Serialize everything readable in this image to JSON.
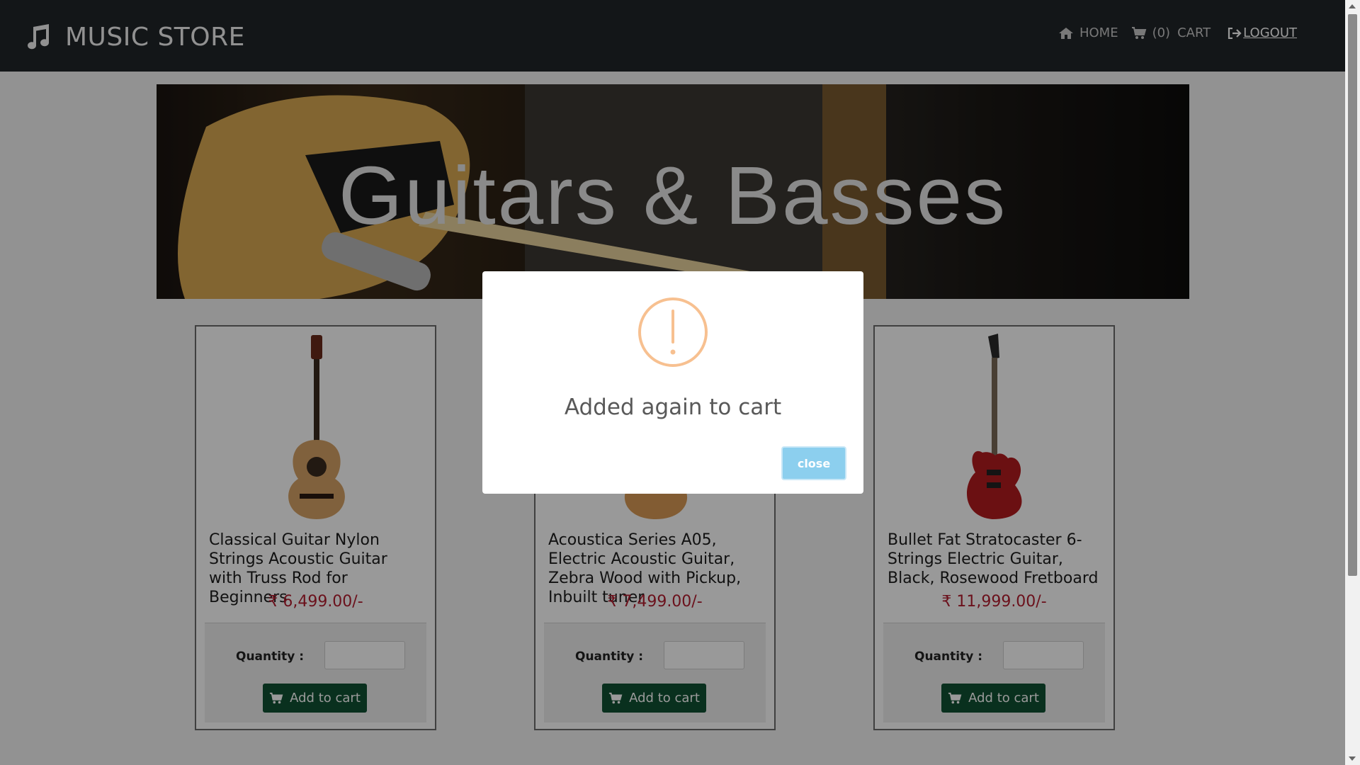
{
  "header": {
    "brand_icon": "music-note-icon",
    "brand": "MUSIC STORE",
    "nav": {
      "home_icon": "home-icon",
      "home": "HOME",
      "cart_icon": "cart-icon",
      "cart_count": "(0)",
      "cart": "CART",
      "logout_icon": "logout-icon",
      "logout": "LOGOUT"
    }
  },
  "banner": {
    "title": "Guitars & Basses"
  },
  "products": [
    {
      "name": "Classical Guitar Nylon Strings Acoustic Guitar with Truss Rod for Beginners",
      "price": "₹ 6,499.00/-",
      "quantity_label": "Quantity :",
      "add_label": "Add to cart"
    },
    {
      "name": "Acoustica Series A05, Electric Acoustic Guitar, Zebra Wood with Pickup, Inbuilt tuner",
      "price": "₹ 7,499.00/-",
      "quantity_label": "Quantity :",
      "add_label": "Add to cart"
    },
    {
      "name": "Bullet Fat Stratocaster 6-Strings Electric Guitar, Black, Rosewood Fretboard",
      "price": "₹ 11,999.00/-",
      "quantity_label": "Quantity :",
      "add_label": "Add to cart"
    }
  ],
  "modal": {
    "icon": "exclamation-circle-icon",
    "message": "Added again to cart",
    "close_label": "close"
  },
  "colors": {
    "navbar": "#212529",
    "price": "#b31d2f",
    "add_button": "#0f5132",
    "close_button": "#8ccfee",
    "warning_icon": "#f7c090"
  }
}
